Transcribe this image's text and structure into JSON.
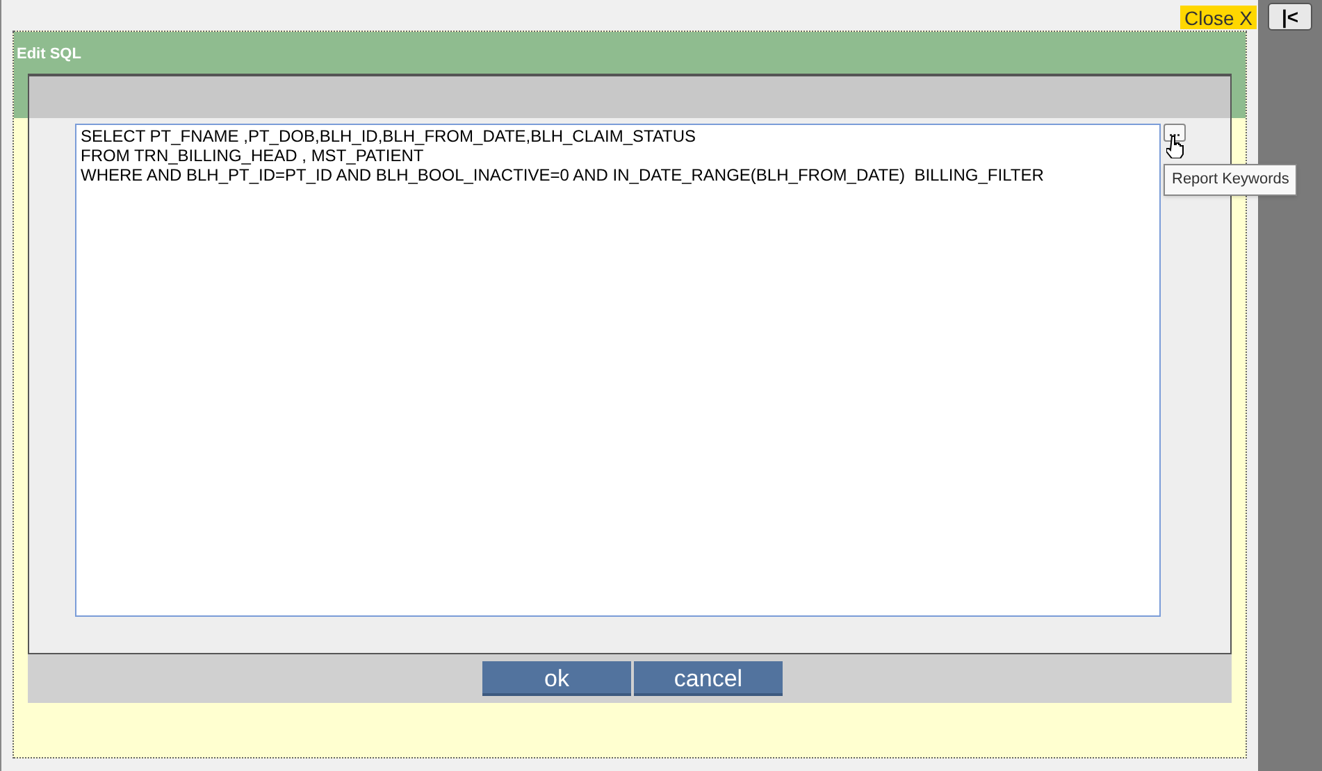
{
  "close_button": "Close X",
  "side_button": "|<",
  "dialog": {
    "title": "Edit SQL",
    "sql_lines": [
      "SELECT PT_FNAME ,PT_DOB,BLH_ID,BLH_FROM_DATE,BLH_CLAIM_STATUS",
      "FROM TRN_BILLING_HEAD , MST_PATIENT",
      "WHERE AND BLH_PT_ID=PT_ID AND BLH_BOOL_INACTIVE=0 AND IN_DATE_RANGE(BLH_FROM_DATE)  BILLING_FILTER"
    ],
    "keywords_button": "...",
    "tooltip": "Report Keywords",
    "buttons": [
      "ok",
      "cancel"
    ]
  }
}
